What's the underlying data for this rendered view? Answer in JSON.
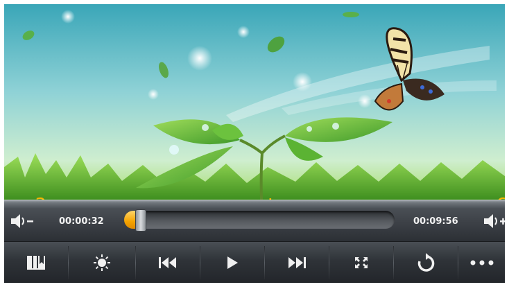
{
  "player": {
    "current_time": "00:00:32",
    "total_time": "00:09:56",
    "progress": 0.058
  },
  "annotations": {
    "a": "a",
    "b": "b",
    "c": "c"
  },
  "icons": {
    "volume_down": "volume-down-icon",
    "volume_up": "volume-up-icon",
    "bookmark": "bookmark-icon",
    "brightness": "brightness-icon",
    "previous": "previous-icon",
    "play": "play-icon",
    "next": "next-icon",
    "display_mode": "display-mode-icon",
    "repeat": "repeat-icon",
    "more": "more-icon"
  },
  "colors": {
    "accent": "#f5a300",
    "annotation": "#f4b400",
    "bar_dark": "#2b2f34"
  }
}
